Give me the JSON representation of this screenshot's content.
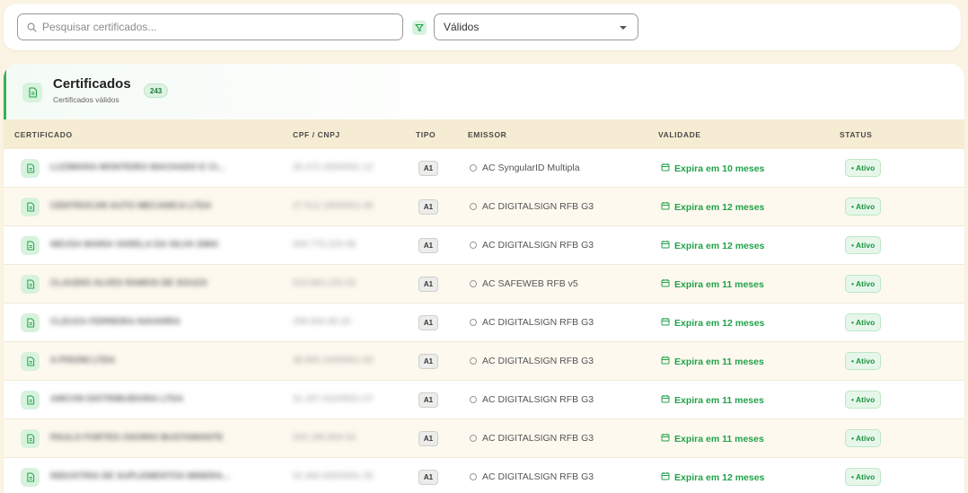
{
  "search": {
    "placeholder": "Pesquisar certificados..."
  },
  "filter": {
    "selected": "Válidos"
  },
  "card": {
    "title": "Certificados",
    "subtitle": "Certificados válidos",
    "count": "243"
  },
  "columns": {
    "certificado": "CERTIFICADO",
    "cpf_cnpj": "CPF / CNPJ",
    "tipo": "TIPO",
    "emissor": "EMISSOR",
    "validade": "VALIDADE",
    "status": "STATUS"
  },
  "rows": [
    {
      "name": "LUZIMARA MONTEIRO MACHADO E CI...",
      "doc": "26.472.255/0001-12",
      "type": "A1",
      "issuer": "AC SyngularID Multipla",
      "validity": "Expira em 10 meses",
      "status": "• Ativo"
    },
    {
      "name": "CENTROCAR AUTO MECANICA LTDA",
      "doc": "27.512.180/0001-06",
      "type": "A1",
      "issuer": "AC DIGITALSIGN RFB G3",
      "validity": "Expira em 12 meses",
      "status": "• Ativo"
    },
    {
      "name": "NEUSA MARIA VARELA DA SILVA SIMA",
      "doc": "009.775.225-08",
      "type": "A1",
      "issuer": "AC DIGITALSIGN RFB G3",
      "validity": "Expira em 12 meses",
      "status": "• Ativo"
    },
    {
      "name": "CLAUDIO ALVES RAMOS DE SOUZA",
      "doc": "023.964.225-53",
      "type": "A1",
      "issuer": "AC SAFEWEB RFB v5",
      "validity": "Expira em 11 meses",
      "status": "• Ativo"
    },
    {
      "name": "CLEUZA FERREIRA NAVARRA",
      "doc": "299.694.95-20",
      "type": "A1",
      "issuer": "AC DIGITALSIGN RFB G3",
      "validity": "Expira em 12 meses",
      "status": "• Ativo"
    },
    {
      "name": "A PISONI LTDA",
      "doc": "38.900.240/0001-60",
      "type": "A1",
      "issuer": "AC DIGITALSIGN RFB G3",
      "validity": "Expira em 11 meses",
      "status": "• Ativo"
    },
    {
      "name": "AMCON DISTRIBUIDORA LTDA",
      "doc": "31.297.042/0001-07",
      "type": "A1",
      "issuer": "AC DIGITALSIGN RFB G3",
      "validity": "Expira em 11 meses",
      "status": "• Ativo"
    },
    {
      "name": "PAULO FORTES OSORIO BUSTAMANTE",
      "doc": "025.195.904-54",
      "type": "A1",
      "issuer": "AC DIGITALSIGN RFB G3",
      "validity": "Expira em 11 meses",
      "status": "• Ativo"
    },
    {
      "name": "INDUSTRIA DE SUPLEMENTOS MINERA...",
      "doc": "02.360.935/0001-29",
      "type": "A1",
      "issuer": "AC DIGITALSIGN RFB G3",
      "validity": "Expira em 12 meses",
      "status": "• Ativo"
    }
  ]
}
